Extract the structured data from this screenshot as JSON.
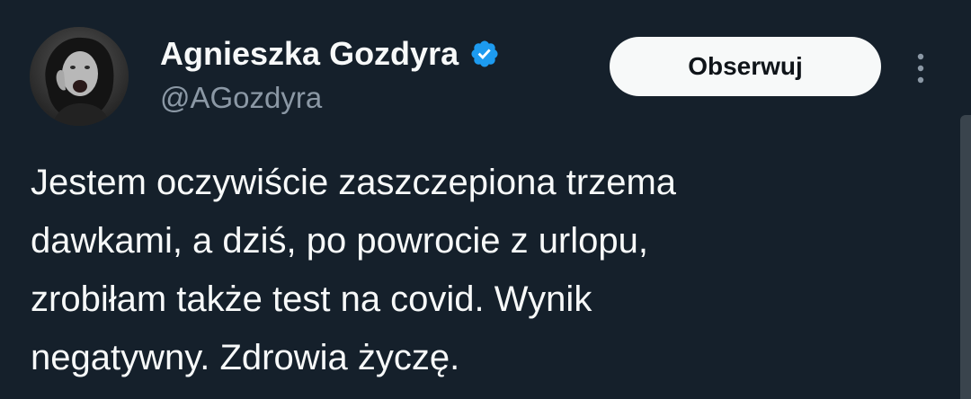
{
  "author": {
    "display_name": "Agnieszka Gozdyra",
    "handle": "@AGozdyra",
    "verified": true,
    "avatar_icon": "profile-photo"
  },
  "actions": {
    "follow_label": "Obserwuj",
    "more_icon": "more-vertical-icon"
  },
  "tweet": {
    "lines": [
      "Jestem oczywiście zaszczepiona trzema",
      "dawkami, a dziś, po powrocie z urlopu,",
      "zrobiłam także test na covid. Wynik",
      "negatywny. Zdrowia życzę."
    ]
  },
  "colors": {
    "background": "#15202b",
    "text": "#f7f9f9",
    "secondary_text": "#8b98a5",
    "verified_badge": "#1d9bf0",
    "button_bg": "#f7f9f9",
    "button_text": "#0f1419"
  }
}
